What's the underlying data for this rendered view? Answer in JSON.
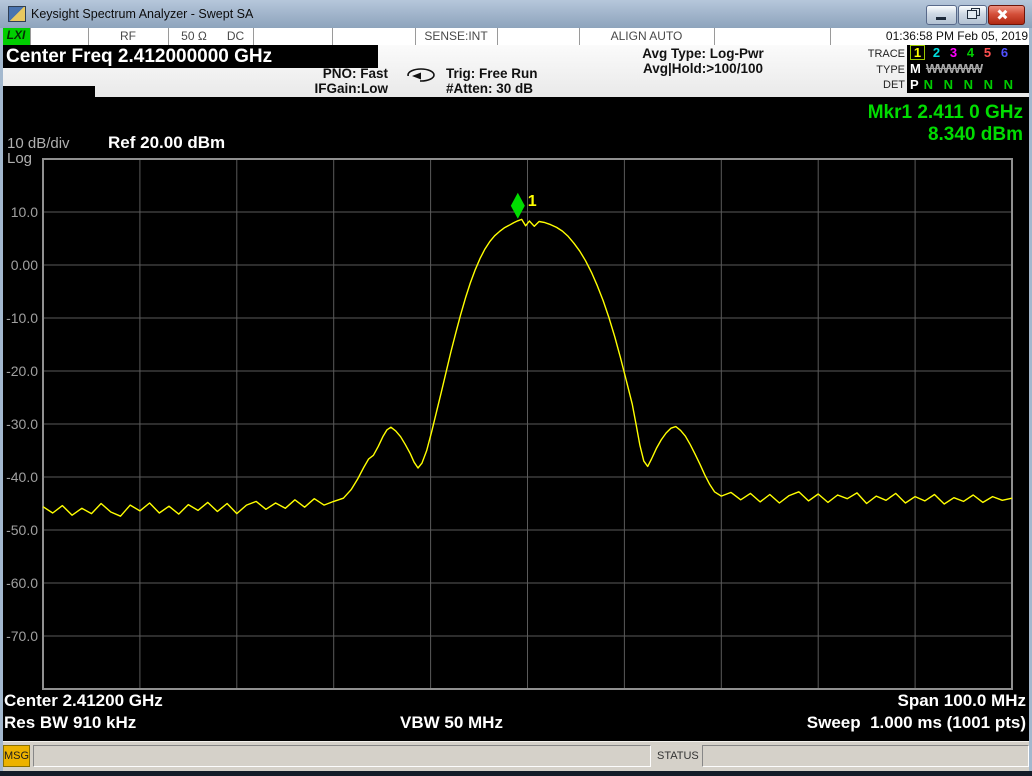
{
  "window": {
    "title": "Keysight Spectrum Analyzer - Swept SA"
  },
  "top_status": {
    "lxi": "LXI",
    "rf": "RF",
    "impedance": "50 Ω",
    "coupling": "DC",
    "sense": "SENSE:INT",
    "align": "ALIGN AUTO",
    "datetime": "01:36:58 PM Feb 05, 2019"
  },
  "annotation": {
    "center_freq": "Center Freq 2.412000000 GHz",
    "pno": "PNO: Fast",
    "ifgain": "IFGain:Low",
    "trig": "Trig: Free Run",
    "atten": "#Atten: 30 dB",
    "avg_type": "Avg Type: Log-Pwr",
    "avg_hold": "Avg|Hold:>100/100",
    "trace_label": "TRACE",
    "type_label": "TYPE",
    "det_label": "DET",
    "traces": [
      {
        "n": "1",
        "color": "#ffff00",
        "active": true
      },
      {
        "n": "2",
        "color": "#00e0e0",
        "active": false
      },
      {
        "n": "3",
        "color": "#ff00ff",
        "active": false
      },
      {
        "n": "4",
        "color": "#00cc00",
        "active": false
      },
      {
        "n": "5",
        "color": "#ff5050",
        "active": false
      },
      {
        "n": "6",
        "color": "#5050ff",
        "active": false
      }
    ],
    "type_active": "M",
    "type_rest": "WWWWW",
    "det_active": "P",
    "det_rest": "N N N N N"
  },
  "marker_readout": {
    "line1": "Mkr1 2.411 0 GHz",
    "line2": "8.340 dBm"
  },
  "display": {
    "scale": "10 dB/div",
    "scale_type": "Log",
    "ref": "Ref 20.00 dBm",
    "y_labels": [
      "10.0",
      "0.00",
      "-10.0",
      "-20.0",
      "-30.0",
      "-40.0",
      "-50.0",
      "-60.0",
      "-70.0"
    ]
  },
  "footer": {
    "center": "Center 2.41200 GHz",
    "span": "Span 100.0 MHz",
    "rbw": "Res BW 910 kHz",
    "vbw": "VBW 50 MHz",
    "sweep": "Sweep  1.000 ms (1001 pts)"
  },
  "status_bar": {
    "msg": "MSG",
    "status": "STATUS"
  },
  "chart_data": {
    "type": "line",
    "title": "Swept SA spectrum trace",
    "x_unit": "MHz",
    "y_unit": "dBm",
    "x_range": [
      2362,
      2462
    ],
    "y_range": [
      -80,
      20
    ],
    "ref_level_dbm": 20,
    "db_per_div": 10,
    "grid_divs": [
      10,
      10
    ],
    "trace_color": "#ffff00",
    "marker": {
      "label": "1",
      "freq_mhz": 2411.0,
      "amp_dbm": 8.34,
      "color": "#00dc00"
    },
    "points": [
      [
        2362,
        -45.6
      ],
      [
        2363,
        -46.8
      ],
      [
        2364,
        -45.4
      ],
      [
        2365,
        -47.2
      ],
      [
        2366,
        -45.9
      ],
      [
        2367,
        -46.9
      ],
      [
        2368,
        -45.0
      ],
      [
        2369,
        -46.6
      ],
      [
        2370,
        -47.4
      ],
      [
        2371,
        -45.3
      ],
      [
        2372,
        -46.4
      ],
      [
        2373,
        -44.9
      ],
      [
        2374,
        -46.8
      ],
      [
        2375,
        -45.5
      ],
      [
        2376,
        -47.0
      ],
      [
        2377,
        -45.2
      ],
      [
        2378,
        -46.3
      ],
      [
        2379,
        -44.8
      ],
      [
        2380,
        -46.5
      ],
      [
        2381,
        -45.0
      ],
      [
        2382,
        -46.9
      ],
      [
        2383,
        -45.3
      ],
      [
        2384,
        -44.6
      ],
      [
        2385,
        -46.1
      ],
      [
        2386,
        -44.9
      ],
      [
        2387,
        -45.9
      ],
      [
        2388,
        -44.3
      ],
      [
        2389,
        -45.7
      ],
      [
        2390,
        -44.1
      ],
      [
        2391,
        -45.3
      ],
      [
        2392,
        -44.6
      ],
      [
        2393,
        -44.0
      ],
      [
        2393.8,
        -42.4
      ],
      [
        2394.5,
        -40.3
      ],
      [
        2395.1,
        -38.2
      ],
      [
        2395.6,
        -36.6
      ],
      [
        2396.1,
        -35.9
      ],
      [
        2396.6,
        -34.2
      ],
      [
        2397.1,
        -32.3
      ],
      [
        2397.5,
        -31.1
      ],
      [
        2397.9,
        -30.6
      ],
      [
        2398.4,
        -31.3
      ],
      [
        2398.9,
        -32.4
      ],
      [
        2399.4,
        -33.9
      ],
      [
        2399.9,
        -35.6
      ],
      [
        2400.3,
        -37.2
      ],
      [
        2400.7,
        -38.3
      ],
      [
        2401.1,
        -37.4
      ],
      [
        2401.6,
        -35.0
      ],
      [
        2402.1,
        -31.5
      ],
      [
        2402.6,
        -27.8
      ],
      [
        2403.1,
        -24.0
      ],
      [
        2403.6,
        -20.2
      ],
      [
        2404.1,
        -16.4
      ],
      [
        2404.6,
        -12.8
      ],
      [
        2405.1,
        -9.4
      ],
      [
        2405.6,
        -6.2
      ],
      [
        2406.1,
        -3.4
      ],
      [
        2406.6,
        -0.9
      ],
      [
        2407.1,
        1.2
      ],
      [
        2407.6,
        3.0
      ],
      [
        2408.1,
        4.4
      ],
      [
        2408.6,
        5.5
      ],
      [
        2409.1,
        6.3
      ],
      [
        2409.6,
        7.0
      ],
      [
        2410.1,
        7.5
      ],
      [
        2410.6,
        8.0
      ],
      [
        2411.0,
        8.34
      ],
      [
        2411.4,
        8.6
      ],
      [
        2411.8,
        7.4
      ],
      [
        2412.2,
        8.3
      ],
      [
        2412.7,
        7.3
      ],
      [
        2413.2,
        8.2
      ],
      [
        2413.8,
        8.0
      ],
      [
        2414.4,
        7.6
      ],
      [
        2415.0,
        7.1
      ],
      [
        2415.6,
        6.4
      ],
      [
        2416.2,
        5.4
      ],
      [
        2416.8,
        4.1
      ],
      [
        2417.4,
        2.6
      ],
      [
        2418.0,
        0.8
      ],
      [
        2418.6,
        -1.4
      ],
      [
        2419.2,
        -3.9
      ],
      [
        2419.8,
        -6.7
      ],
      [
        2420.4,
        -9.9
      ],
      [
        2421.0,
        -13.5
      ],
      [
        2421.6,
        -17.5
      ],
      [
        2422.2,
        -21.8
      ],
      [
        2422.8,
        -26.2
      ],
      [
        2423.2,
        -30.0
      ],
      [
        2423.6,
        -34.0
      ],
      [
        2424.0,
        -37.0
      ],
      [
        2424.4,
        -38.0
      ],
      [
        2424.8,
        -36.6
      ],
      [
        2425.3,
        -34.6
      ],
      [
        2425.8,
        -33.0
      ],
      [
        2426.3,
        -31.7
      ],
      [
        2426.8,
        -30.8
      ],
      [
        2427.3,
        -30.5
      ],
      [
        2427.8,
        -31.2
      ],
      [
        2428.3,
        -32.3
      ],
      [
        2428.8,
        -33.9
      ],
      [
        2429.3,
        -35.7
      ],
      [
        2429.8,
        -37.6
      ],
      [
        2430.3,
        -39.6
      ],
      [
        2430.8,
        -41.4
      ],
      [
        2431.3,
        -42.8
      ],
      [
        2432.0,
        -43.6
      ],
      [
        2433,
        -42.9
      ],
      [
        2434,
        -44.3
      ],
      [
        2435,
        -43.1
      ],
      [
        2436,
        -44.7
      ],
      [
        2437,
        -43.3
      ],
      [
        2438,
        -44.9
      ],
      [
        2439,
        -43.5
      ],
      [
        2440,
        -42.8
      ],
      [
        2441,
        -44.5
      ],
      [
        2442,
        -43.2
      ],
      [
        2443,
        -44.8
      ],
      [
        2444,
        -43.4
      ],
      [
        2445,
        -44.1
      ],
      [
        2446,
        -43.0
      ],
      [
        2447,
        -45.0
      ],
      [
        2448,
        -43.6
      ],
      [
        2449,
        -44.4
      ],
      [
        2450,
        -43.1
      ],
      [
        2451,
        -44.9
      ],
      [
        2452,
        -43.7
      ],
      [
        2453,
        -44.5
      ],
      [
        2454,
        -43.3
      ],
      [
        2455,
        -45.1
      ],
      [
        2456,
        -43.9
      ],
      [
        2457,
        -44.6
      ],
      [
        2458,
        -43.4
      ],
      [
        2459,
        -44.8
      ],
      [
        2460,
        -43.7
      ],
      [
        2461,
        -44.4
      ],
      [
        2462,
        -44.0
      ]
    ]
  }
}
